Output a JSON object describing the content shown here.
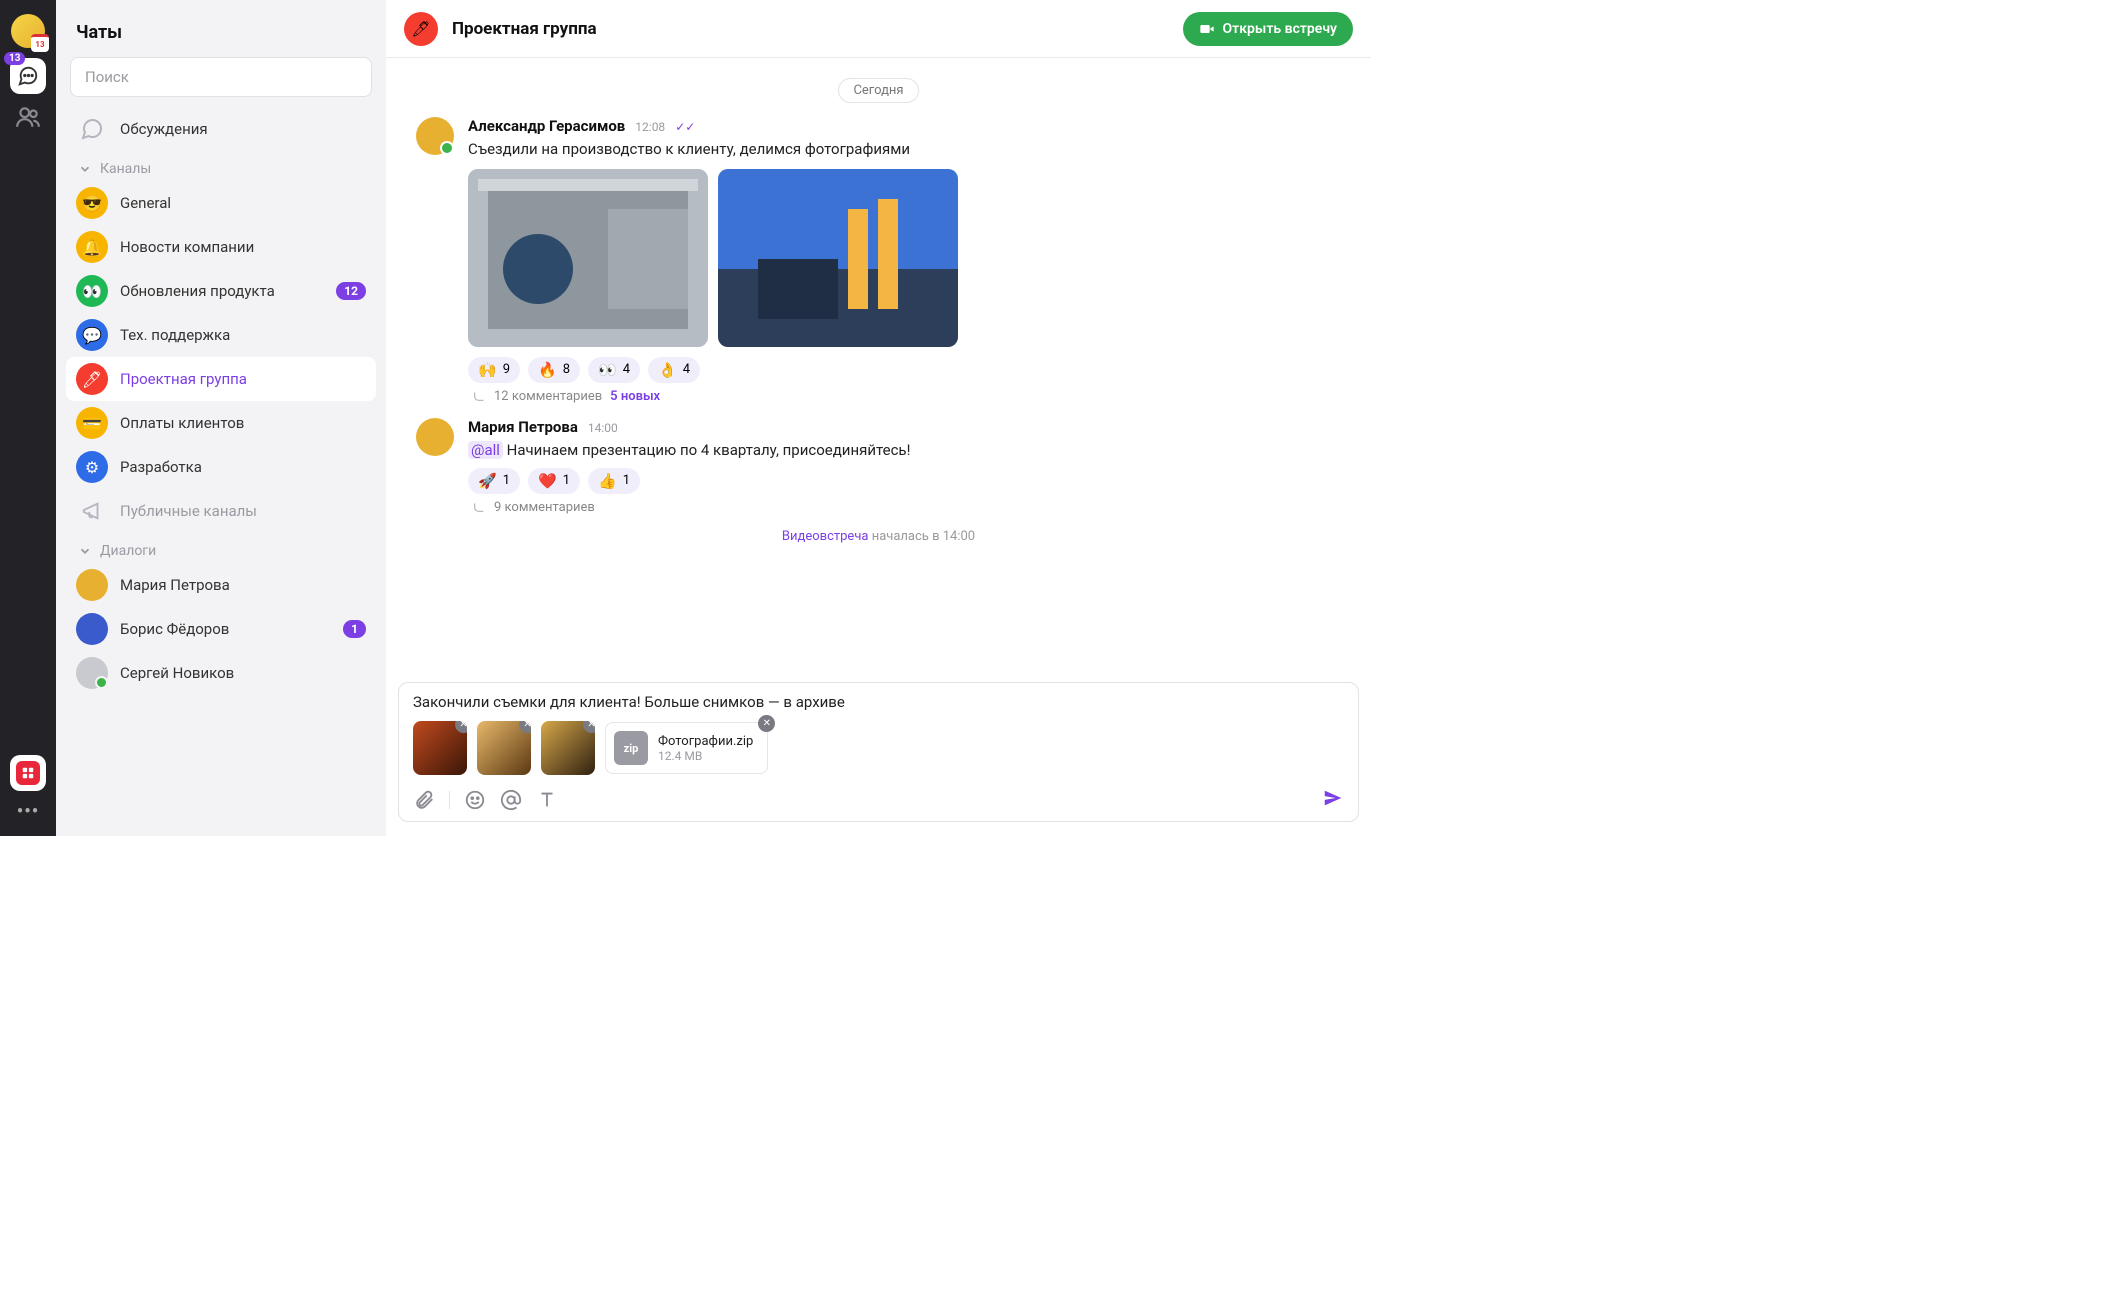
{
  "rail": {
    "calendar_badge": "13",
    "chat_badge": "13"
  },
  "sidebar": {
    "title": "Чаты",
    "search_placeholder": "Поиск",
    "discussions": "Обсуждения",
    "channels_header": "Каналы",
    "dialogs_header": "Диалоги",
    "public_channels": "Публичные каналы",
    "channels": [
      {
        "label": "General",
        "icon": "😎",
        "bg": "#f7b500"
      },
      {
        "label": "Новости компании",
        "icon": "🔔",
        "bg": "#f7b500"
      },
      {
        "label": "Обновления продукта",
        "icon": "👀",
        "bg": "#1eb955",
        "badge": "12"
      },
      {
        "label": "Тех. поддержка",
        "icon": "💬",
        "bg": "#2e6be6"
      },
      {
        "label": "Проектная группа",
        "icon": "🖊",
        "bg": "#f43c2f",
        "active": true
      },
      {
        "label": "Оплаты клиентов",
        "icon": "💳",
        "bg": "#f7b500"
      },
      {
        "label": "Разработка",
        "icon": "⚙",
        "bg": "#2e6be6"
      }
    ],
    "dialogs": [
      {
        "label": "Мария Петрова",
        "bg": "#e8b030"
      },
      {
        "label": "Борис Фёдоров",
        "bg": "#3a5bcc",
        "badge": "1"
      },
      {
        "label": "Сергей Новиков",
        "bg": "#c9c9d0",
        "online": true
      }
    ]
  },
  "main": {
    "channel_name": "Проектная группа",
    "channel_icon": "🖊",
    "meet_button": "Открыть встречу",
    "date_divider": "Сегодня",
    "messages": [
      {
        "author": "Александр Герасимов",
        "time": "12:08",
        "read": true,
        "avatar_bg": "#e8b030",
        "online": true,
        "text": "Съездили на производство к клиенту, делимся фотографиями",
        "photos": 2,
        "reactions": [
          {
            "emoji": "🙌",
            "count": "9"
          },
          {
            "emoji": "🔥",
            "count": "8"
          },
          {
            "emoji": "👀",
            "count": "4"
          },
          {
            "emoji": "👌",
            "count": "4"
          }
        ],
        "comments": "12 комментариев",
        "comments_new": "5 новых"
      },
      {
        "author": "Мария Петрова",
        "time": "14:00",
        "avatar_bg": "#e8b030",
        "mention": "@all",
        "text": " Начинаем презентацию по 4 кварталу, присоединяйтесь!",
        "reactions": [
          {
            "emoji": "🚀",
            "count": "1"
          },
          {
            "emoji": "❤️",
            "count": "1"
          },
          {
            "emoji": "👍",
            "count": "1"
          }
        ],
        "comments": "9 комментариев"
      }
    ],
    "video_notice": {
      "link": "Видеовстреча",
      "rest": " началась в 14:00"
    }
  },
  "composer": {
    "text": "Закончили съемки для клиента! Больше снимков — в архиве",
    "thumbs": 3,
    "file": {
      "name": "Фотографии.zip",
      "size": "12.4 MB",
      "ext": "zip"
    }
  }
}
